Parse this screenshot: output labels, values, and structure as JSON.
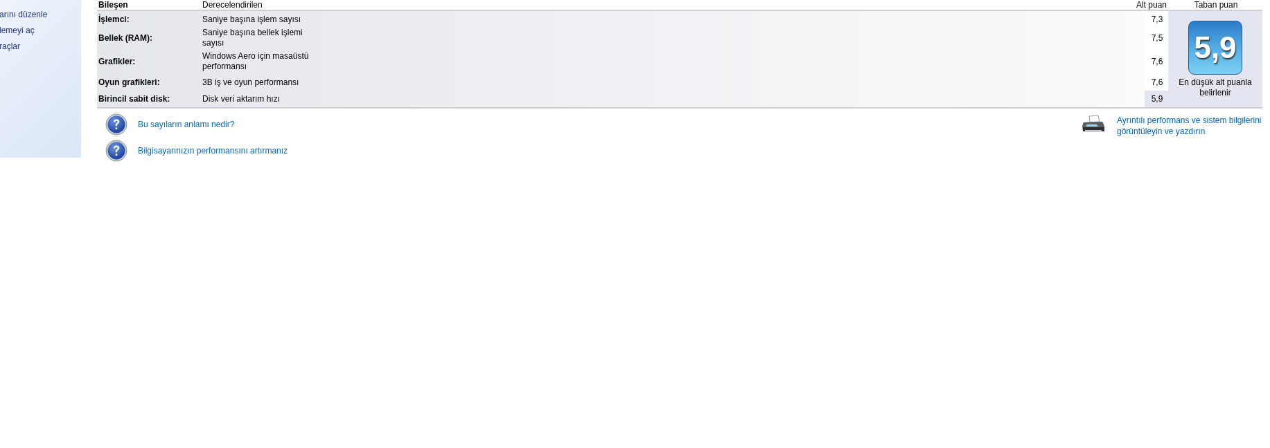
{
  "sidebar": {
    "items": [
      "arını düzenle",
      "lemeyi aç",
      "raçlar"
    ]
  },
  "table": {
    "columns": [
      "Bileşen",
      "Derecelendirilen",
      "Alt puan",
      "Taban puan"
    ],
    "rows": [
      {
        "component": "İşlemci:",
        "rated": "Saniye başına işlem sayısı",
        "subscore": "7,3",
        "lowest": false
      },
      {
        "component": "Bellek (RAM):",
        "rated": "Saniye başına bellek işlemi sayısı",
        "subscore": "7,5",
        "lowest": false
      },
      {
        "component": "Grafikler:",
        "rated": "Windows Aero için masaüstü performansı",
        "subscore": "7,6",
        "lowest": false
      },
      {
        "component": "Oyun grafikleri:",
        "rated": "3B iş ve oyun performansı",
        "subscore": "7,6",
        "lowest": false
      },
      {
        "component": "Birincil sabit disk:",
        "rated": "Disk veri aktarım hızı",
        "subscore": "5,9",
        "lowest": true
      }
    ],
    "base_score": {
      "value": "5,9",
      "caption": "En düşük alt puanla belirlenir"
    }
  },
  "links": {
    "left": [
      "Bu sayıların anlamı nedir?",
      "Bilgisayarınızın performansını artırmanız"
    ],
    "right": "Ayrıntılı performans ve sistem bilgilerini görüntüleyin ve yazdırın"
  }
}
